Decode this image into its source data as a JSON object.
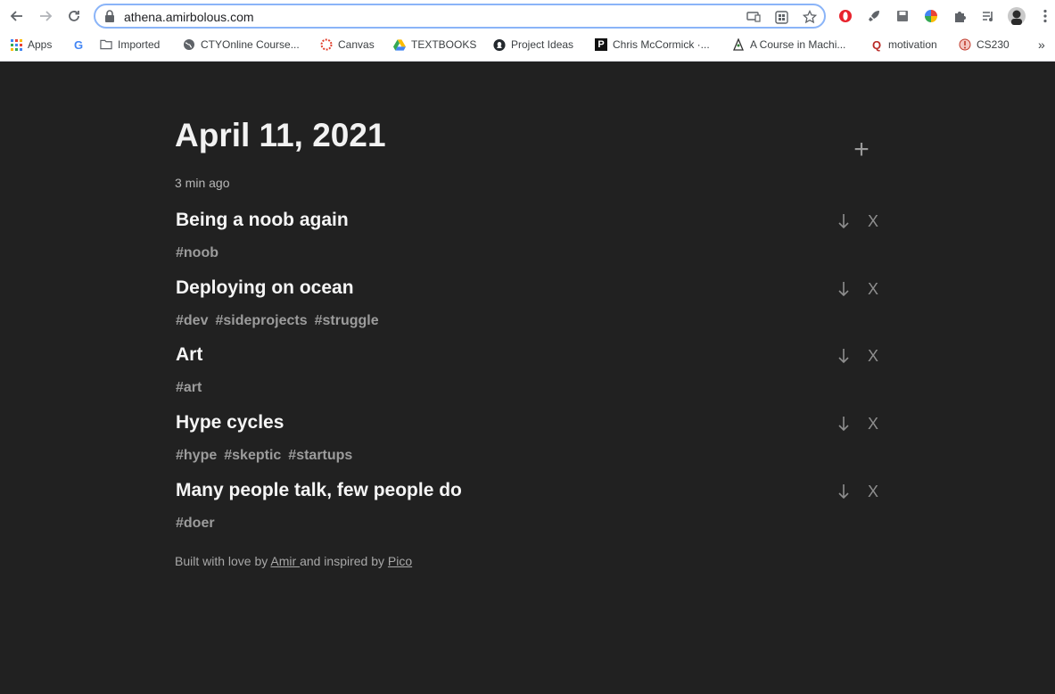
{
  "browser": {
    "url": "athena.amirbolous.com",
    "bookmarks": [
      {
        "label": "Apps",
        "icon": "apps-grid-icon"
      },
      {
        "label": "",
        "icon": "google-icon"
      },
      {
        "label": "Imported",
        "icon": "folder-icon"
      },
      {
        "label": "CTYOnline Course...",
        "icon": "globe-icon"
      },
      {
        "label": "Canvas",
        "icon": "canvas-icon"
      },
      {
        "label": "TEXTBOOKS",
        "icon": "drive-icon"
      },
      {
        "label": "Project Ideas",
        "icon": "github-icon"
      },
      {
        "label": "Chris McCormick ·...",
        "icon": "p-icon"
      },
      {
        "label": "A Course in Machi...",
        "icon": "ml-icon"
      },
      {
        "label": "motivation",
        "icon": "quora-icon"
      },
      {
        "label": "CS230",
        "icon": "cs230-icon"
      }
    ],
    "more_bookmarks": "»"
  },
  "page": {
    "date_title": "April 11, 2021",
    "add_label": "+",
    "updated": "3 min ago",
    "entries": [
      {
        "title": "Being a noob again",
        "tags": [
          "#noob"
        ]
      },
      {
        "title": "Deploying on ocean",
        "tags": [
          "#dev",
          "#sideprojects",
          "#struggle"
        ]
      },
      {
        "title": "Art",
        "tags": [
          "#art"
        ]
      },
      {
        "title": "Hype cycles",
        "tags": [
          "#hype",
          "#skeptic",
          "#startups"
        ]
      },
      {
        "title": "Many people talk, few people do",
        "tags": [
          "#doer"
        ]
      }
    ],
    "close_label": "X",
    "footer": {
      "prefix": "Built with love by ",
      "author": "Amir ",
      "middle": "and inspired by ",
      "inspiration": "Pico"
    }
  },
  "colors": {
    "background": "#212121",
    "title": "#f2f2f2",
    "tag": "#9c9c9c"
  }
}
